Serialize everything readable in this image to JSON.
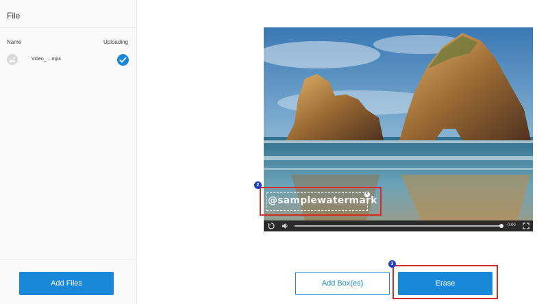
{
  "sidebar": {
    "title": "File",
    "columns": {
      "name": "Name",
      "status": "Uploading"
    },
    "files": [
      {
        "name": "Video_....mp4",
        "uploaded": true
      }
    ],
    "add_files_label": "Add Files"
  },
  "video": {
    "watermark_text": "@samplewatermark",
    "time_remaining": "-0:00",
    "progress": 0.97
  },
  "steps": {
    "box_step": "2",
    "erase_step": "3"
  },
  "actions": {
    "add_box_label": "Add Box(es)",
    "erase_label": "Erase"
  },
  "colors": {
    "accent": "#1a88d8",
    "highlight": "#d42a2a",
    "badge": "#1d3ec7"
  }
}
